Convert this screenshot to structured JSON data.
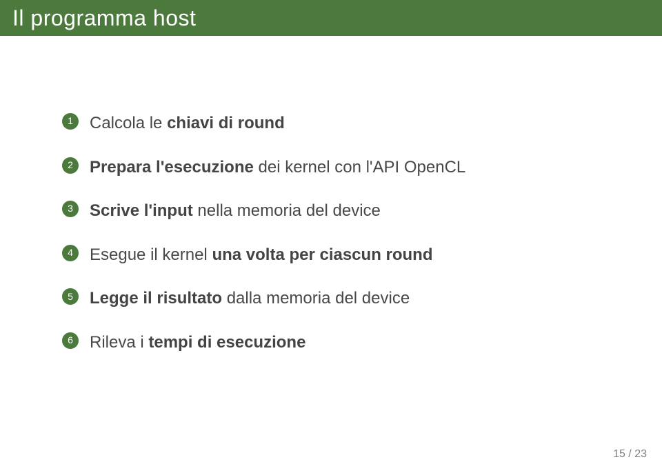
{
  "title": "Il programma host",
  "items": [
    {
      "pre": "Calcola le ",
      "bold": "chiavi di round",
      "post": ""
    },
    {
      "pre": "",
      "bold": "Prepara l'esecuzione",
      "post": " dei kernel con l'API OpenCL"
    },
    {
      "pre": "",
      "bold": "Scrive l'input",
      "post": " nella memoria del device"
    },
    {
      "pre": "Esegue il kernel ",
      "bold": "una volta per ciascun round",
      "post": ""
    },
    {
      "pre": "",
      "bold": "Legge il risultato",
      "post": " dalla memoria del device"
    },
    {
      "pre": "Rileva i ",
      "bold": "tempi di esecuzione",
      "post": ""
    }
  ],
  "page": {
    "current": "15",
    "sep": " / ",
    "total": "23"
  }
}
